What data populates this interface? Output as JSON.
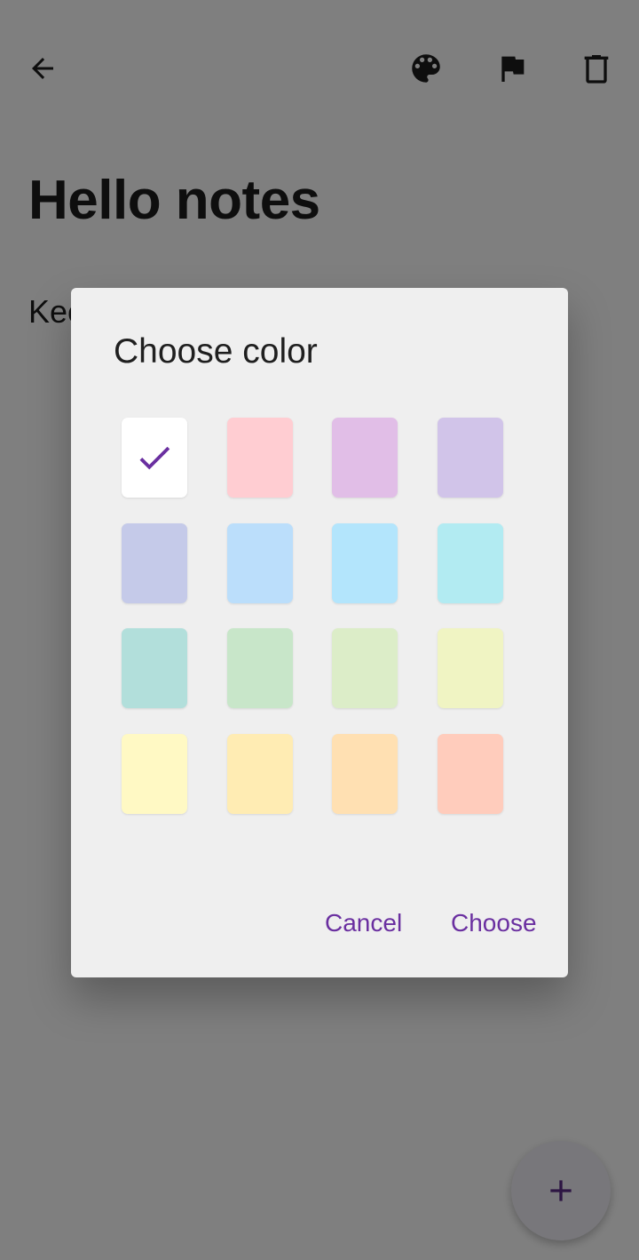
{
  "note": {
    "title": "Hello notes",
    "body": "Keep"
  },
  "toolbar": {
    "back_icon": "arrow-left-icon",
    "palette_icon": "palette-icon",
    "flag_icon": "flag-icon",
    "delete_icon": "trash-icon"
  },
  "fab": {
    "icon": "plus-icon",
    "color": "#5b2a86"
  },
  "dialog": {
    "title": "Choose color",
    "cancel_label": "Cancel",
    "choose_label": "Choose",
    "accent": "#6a2fa0",
    "selected_index": 0,
    "swatches": [
      "#ffffff",
      "#ffcdd2",
      "#e1bee7",
      "#d1c4e9",
      "#c5cae9",
      "#bbdefb",
      "#b3e5fc",
      "#b2ebf2",
      "#b2dfdb",
      "#c8e6c9",
      "#dcedc8",
      "#f0f4c3",
      "#fff9c4",
      "#ffecb3",
      "#ffe0b2",
      "#ffccbc"
    ]
  }
}
